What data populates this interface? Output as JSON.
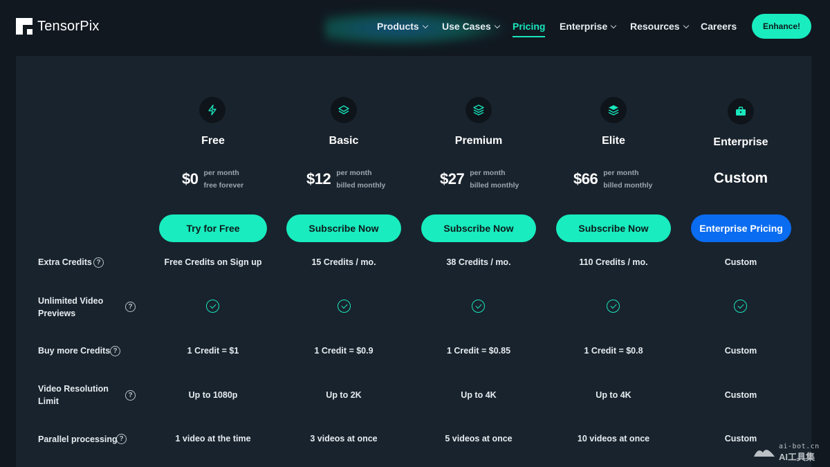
{
  "brand": {
    "name": "TensorPix"
  },
  "nav": {
    "items": [
      {
        "label": "Products",
        "has_dropdown": true
      },
      {
        "label": "Use Cases",
        "has_dropdown": true
      },
      {
        "label": "Pricing",
        "active": true
      },
      {
        "label": "Enterprise",
        "has_dropdown": true
      },
      {
        "label": "Resources",
        "has_dropdown": true
      },
      {
        "label": "Careers"
      }
    ],
    "cta_label": "Enhance!"
  },
  "plans": [
    {
      "name": "Free",
      "icon": "bolt-icon",
      "price": "$0",
      "note1": "per month",
      "note2": "free forever",
      "button": "Try for Free"
    },
    {
      "name": "Basic",
      "icon": "layers-outline-icon",
      "price": "$12",
      "note1": "per month",
      "note2": "billed monthly",
      "button": "Subscribe Now"
    },
    {
      "name": "Premium",
      "icon": "layers-stack-icon",
      "price": "$27",
      "note1": "per month",
      "note2": "billed monthly",
      "button": "Subscribe Now"
    },
    {
      "name": "Elite",
      "icon": "layers-filled-icon",
      "price": "$66",
      "note1": "per month",
      "note2": "billed monthly",
      "button": "Subscribe Now"
    },
    {
      "name": "Enterprise",
      "icon": "briefcase-icon",
      "price": "Custom",
      "button": "Enterprise Pricing"
    }
  ],
  "features": [
    {
      "label": "Extra Credits",
      "values": [
        "Free Credits on Sign up",
        "15 Credits / mo.",
        "38 Credits / mo.",
        "110 Credits / mo.",
        "Custom"
      ]
    },
    {
      "label": "Unlimited Video Previews",
      "values": [
        "check",
        "check",
        "check",
        "check",
        "check"
      ]
    },
    {
      "label": "Buy more Credits",
      "values": [
        "1 Credit = $1",
        "1 Credit = $0.9",
        "1 Credit = $0.85",
        "1 Credit = $0.8",
        "Custom"
      ]
    },
    {
      "label": "Video Resolution Limit",
      "values": [
        "Up to 1080p",
        "Up to 2K",
        "Up to 4K",
        "Up to 4K",
        "Custom"
      ]
    },
    {
      "label": "Parallel processing",
      "values": [
        "1 video at the time",
        "3 videos at once",
        "5 videos at once",
        "10 videos at once",
        "Custom"
      ]
    }
  ],
  "help_glyph": "?",
  "watermark": {
    "line1": "ai-bot.cn",
    "line2": "AI工具集"
  },
  "colors": {
    "accent": "#19ecbf",
    "enterprise_button": "#0a6cf0",
    "panel": "#19232d",
    "page": "#111820"
  }
}
